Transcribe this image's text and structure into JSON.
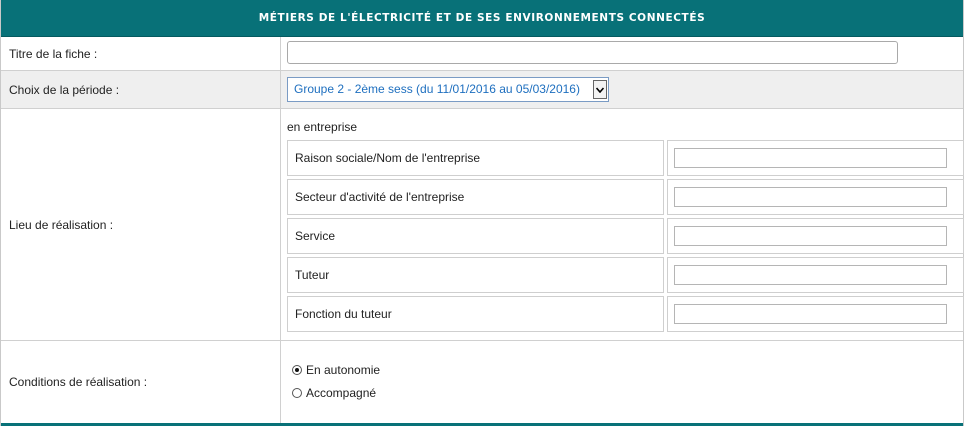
{
  "header": {
    "title": "MÉTIERS DE L'ÉLECTRICITÉ ET DE SES ENVIRONNEMENTS CONNECTÉS"
  },
  "form": {
    "titre": {
      "label": "Titre de la fiche :",
      "value": ""
    },
    "periode": {
      "label": "Choix de la période :",
      "selected": "Groupe 2 - 2ème sess (du 11/01/2016 au 05/03/2016)",
      "dropdown_icon": "chevron-down-icon"
    },
    "lieu": {
      "label": "Lieu de réalisation :",
      "type": "en entreprise",
      "fields": [
        {
          "label": "Raison sociale/Nom de l'entreprise",
          "value": ""
        },
        {
          "label": "Secteur d'activité de l'entreprise",
          "value": ""
        },
        {
          "label": "Service",
          "value": ""
        },
        {
          "label": "Tuteur",
          "value": ""
        },
        {
          "label": "Fonction du tuteur",
          "value": ""
        }
      ]
    },
    "conditions": {
      "label": "Conditions de réalisation :",
      "options": [
        {
          "label": "En autonomie",
          "checked": true
        },
        {
          "label": "Accompagné",
          "checked": false
        }
      ]
    }
  },
  "colors": {
    "header_bg": "#087178",
    "header_text": "#ffffff",
    "link_blue": "#1e6fbf",
    "row_alt_bg": "#efefef"
  }
}
